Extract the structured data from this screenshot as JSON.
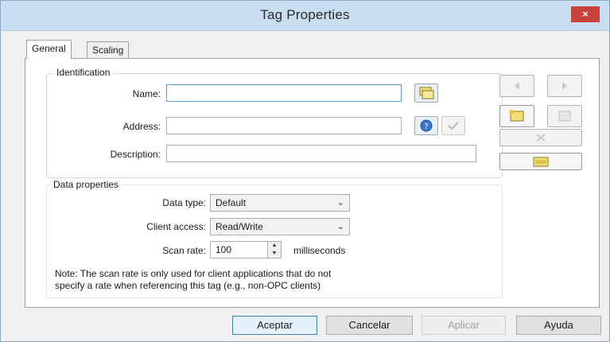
{
  "window": {
    "title": "Tag Properties",
    "close_glyph": "×"
  },
  "tabs": [
    {
      "label": "General",
      "active": true
    },
    {
      "label": "Scaling",
      "active": false
    }
  ],
  "identification": {
    "title": "Identification",
    "name_label": "Name:",
    "name_value": "",
    "address_label": "Address:",
    "address_value": "",
    "description_label": "Description:",
    "description_value": "",
    "name_icon": "browse-tags-icon",
    "address_help_icon": "help-icon",
    "address_check_icon": "check-icon"
  },
  "data_properties": {
    "title": "Data properties",
    "data_type_label": "Data type:",
    "data_type_value": "Default",
    "client_access_label": "Client access:",
    "client_access_value": "Read/Write",
    "scan_rate_label": "Scan rate:",
    "scan_rate_value": "100",
    "scan_rate_unit": "milliseconds",
    "note_line1": "Note: The scan rate is only used for client applications that do not",
    "note_line2": "specify a rate when referencing this tag (e.g., non-OPC clients)"
  },
  "side_toolbar": {
    "icons": [
      "previous-icon",
      "next-icon",
      "new-tag-icon",
      "copy-tag-icon",
      "delete-icon",
      "folder-icon"
    ]
  },
  "buttons": {
    "ok": "Aceptar",
    "cancel": "Cancelar",
    "apply": "Aplicar",
    "help": "Ayuda"
  },
  "colors": {
    "titlebar": "#c9ddf1",
    "close": "#c7423a",
    "default_button_border": "#3c7fb1"
  }
}
